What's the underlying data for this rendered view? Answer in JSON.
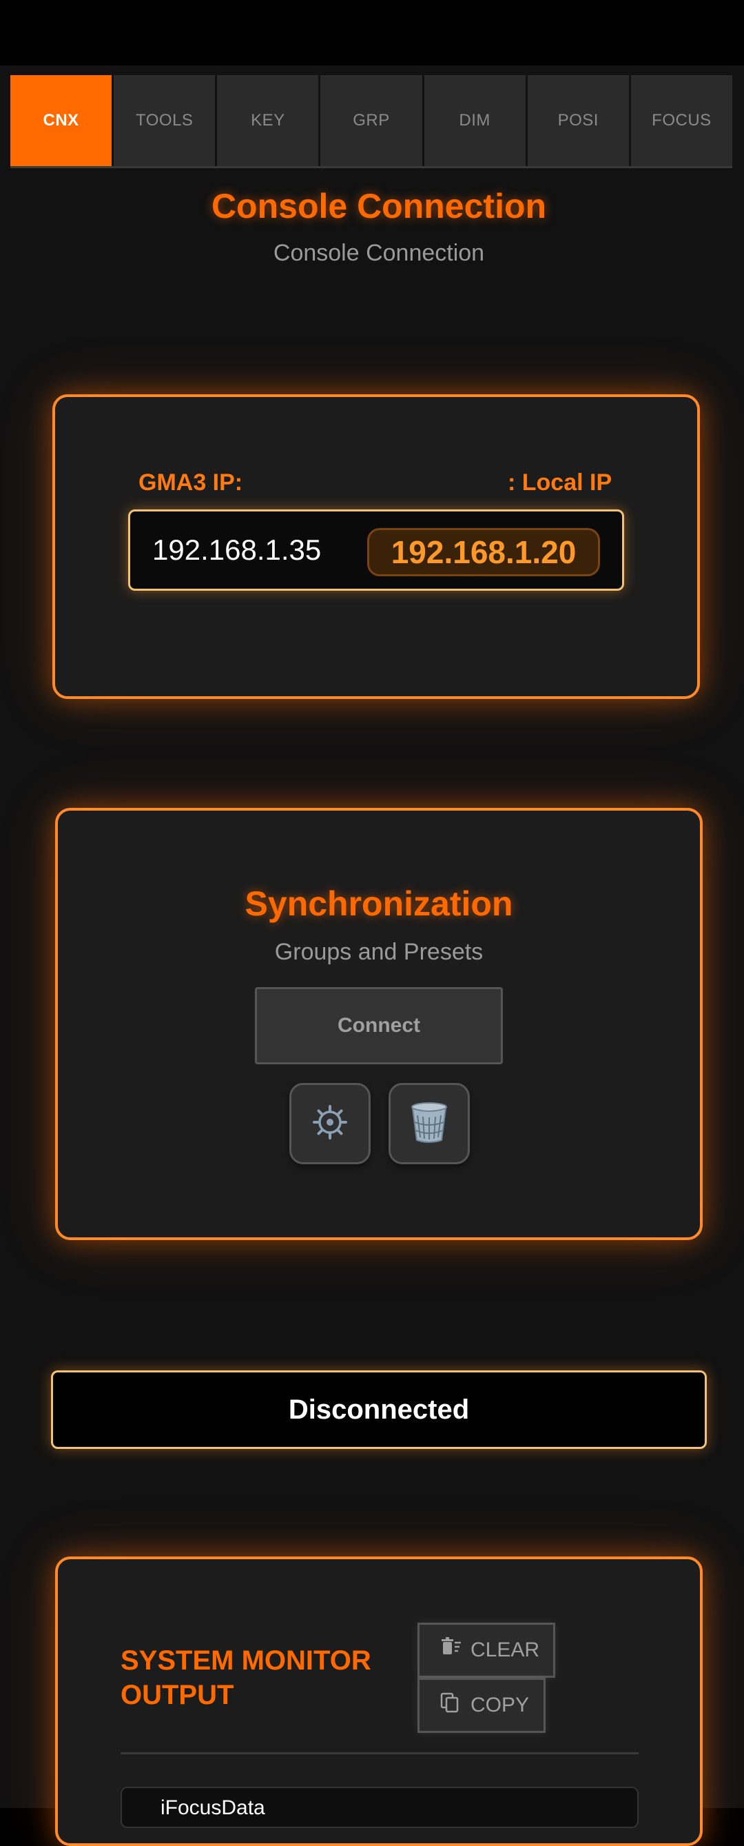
{
  "tabs": [
    {
      "label": "CNX",
      "active": true
    },
    {
      "label": "TOOLS",
      "active": false
    },
    {
      "label": "KEY",
      "active": false
    },
    {
      "label": "GRP",
      "active": false
    },
    {
      "label": "DIM",
      "active": false
    },
    {
      "label": "POSI",
      "active": false
    },
    {
      "label": "FOCUS",
      "active": false
    }
  ],
  "header": {
    "title": "Console Connection",
    "subtitle": "Console Connection"
  },
  "connection": {
    "gma3_label": "GMA3 IP:",
    "local_label": ": Local IP",
    "gma3_ip": "192.168.1.35",
    "local_ip": "192.168.1.20"
  },
  "sync": {
    "title": "Synchronization",
    "subtitle": "Groups and Presets",
    "connect_label": "Connect",
    "settings_icon": "gear-icon",
    "delete_icon": "trash-icon"
  },
  "status": {
    "text": "Disconnected"
  },
  "monitor": {
    "title": "SYSTEM MONITOR OUTPUT",
    "clear_label": "CLEAR",
    "copy_label": "COPY",
    "log_first_line": "iFocusData"
  },
  "colors": {
    "accent": "#ff6a00",
    "background": "#121212",
    "card": "#1c1c1c"
  }
}
